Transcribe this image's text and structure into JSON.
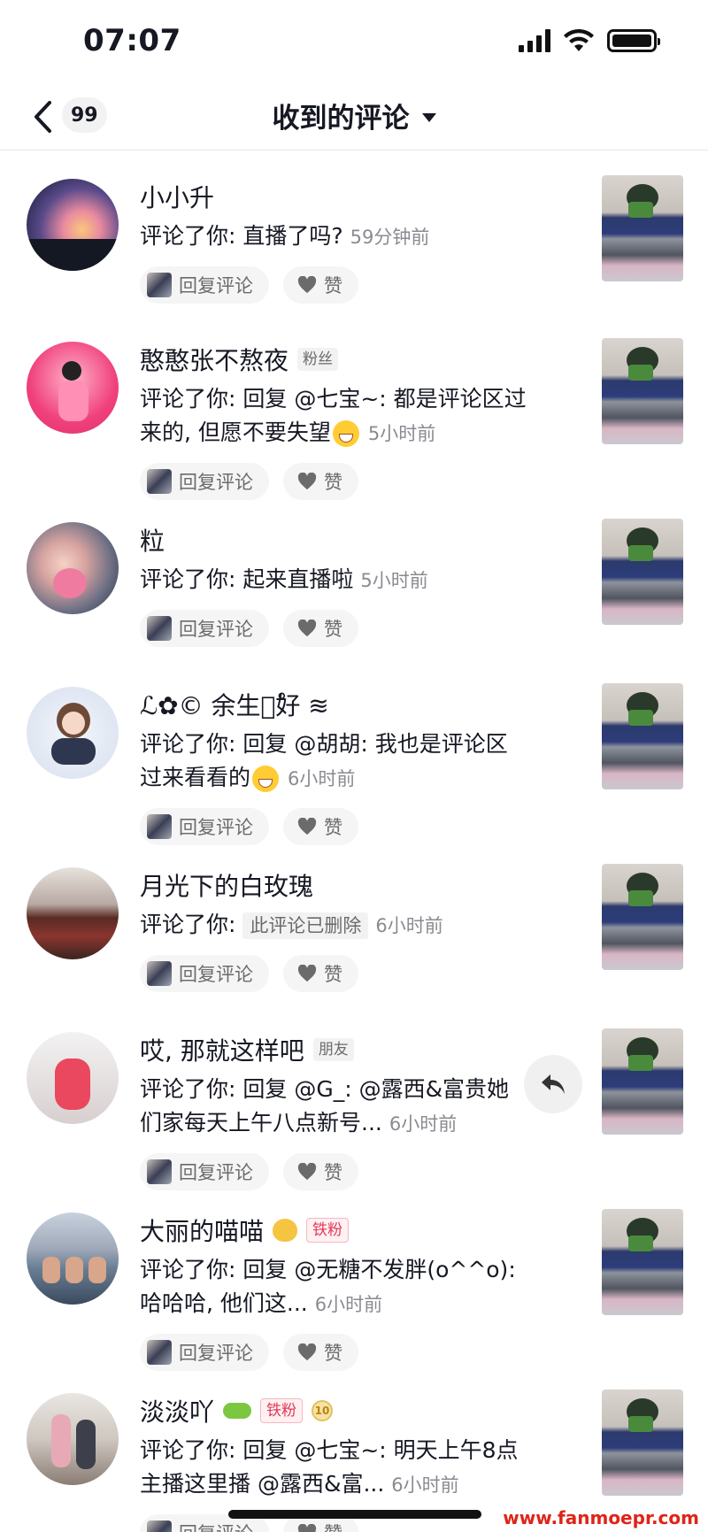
{
  "status_bar": {
    "time": "07:07"
  },
  "header": {
    "back_count": "99",
    "title": "收到的评论"
  },
  "buttons": {
    "reply": "回复评论",
    "like": "赞"
  },
  "items": [
    {
      "name": "小小升",
      "prefix": "评论了你: ",
      "text": "直播了吗?",
      "time": "59分钟前"
    },
    {
      "name": "憨憨张不熬夜",
      "tag": "粉丝",
      "prefix": "评论了你: ",
      "text": "回复 @七宝~: 都是评论区过来的, 但愿不要失望",
      "time": "5小时前"
    },
    {
      "name": "粒",
      "prefix": "评论了你: ",
      "text": "起来直播啦",
      "time": "5小时前"
    },
    {
      "name": "ℒ✿© 余生安ْ好 ≋",
      "prefix": "评论了你: ",
      "text": "回复 @胡胡: 我也是评论区过来看看的",
      "time": "6小时前"
    },
    {
      "name": "月光下的白玫瑰",
      "prefix": "评论了你: ",
      "deleted": "此评论已删除",
      "time": "6小时前"
    },
    {
      "name": "哎, 那就这样吧",
      "tag": "朋友",
      "prefix": "评论了你: ",
      "text": "回复 @G_: @露西&富贵她们家每天上午八点新号...",
      "time": "6小时前"
    },
    {
      "name": "大丽的喵喵",
      "tag": "铁粉",
      "prefix": "评论了你: ",
      "text": "回复 @无糖不发胖(o^^o): 哈哈哈, 他们这...",
      "time": "6小时前"
    },
    {
      "name": "淡淡吖",
      "tag": "铁粉",
      "medal": "10",
      "prefix": "评论了你: ",
      "text": "回复 @七宝~: 明天上午8点主播这里播 @露西&富...",
      "time": "6小时前"
    }
  ],
  "watermark": "www.fanmoepr.com",
  "colors": {
    "accent": "#e03a5a",
    "text": "#161823",
    "muted": "#8a8b91"
  }
}
